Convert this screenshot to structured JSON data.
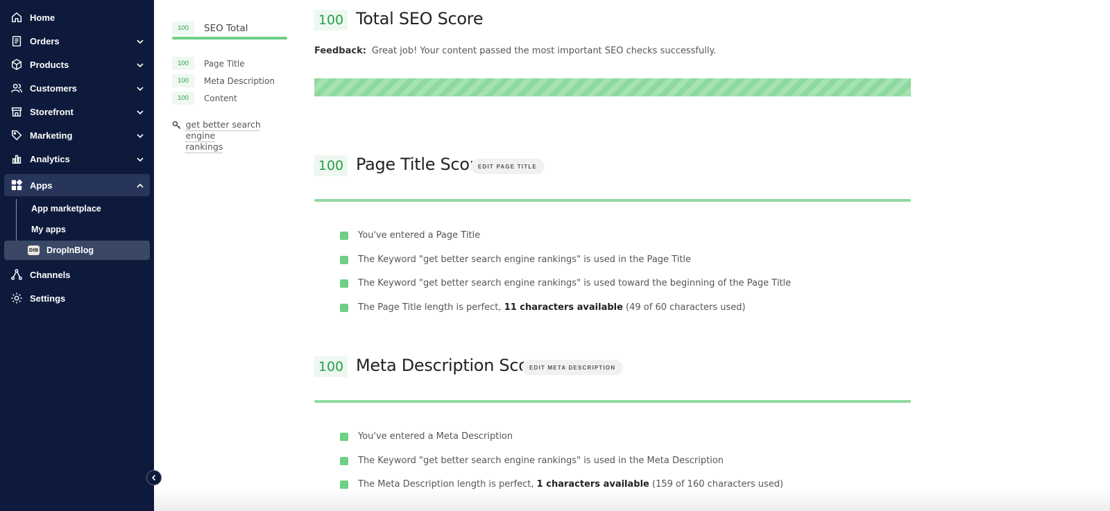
{
  "sidebar": {
    "items": [
      {
        "label": "Home",
        "icon": "home-icon"
      },
      {
        "label": "Orders",
        "icon": "orders-icon"
      },
      {
        "label": "Products",
        "icon": "box-icon"
      },
      {
        "label": "Customers",
        "icon": "users-icon"
      },
      {
        "label": "Storefront",
        "icon": "storefront-icon"
      },
      {
        "label": "Marketing",
        "icon": "tag-icon"
      },
      {
        "label": "Analytics",
        "icon": "bar-chart-icon"
      },
      {
        "label": "Apps",
        "icon": "apps-icon"
      },
      {
        "label": "Channels",
        "icon": "channels-icon"
      },
      {
        "label": "Settings",
        "icon": "gear-icon"
      }
    ],
    "apps_sub": {
      "marketplace": "App marketplace",
      "my_apps": "My apps",
      "dropinblog": "DropInBlog",
      "dropinblog_logo": "DIB"
    }
  },
  "toc": {
    "total_score": "100",
    "total_label": "SEO Total",
    "items": [
      {
        "score": "100",
        "label": "Page Title"
      },
      {
        "score": "100",
        "label": "Meta Description"
      },
      {
        "score": "100",
        "label": "Content"
      }
    ],
    "keyword_line1": "get better search engine",
    "keyword_line2": "rankings"
  },
  "total": {
    "score": "100",
    "title": "Total SEO Score",
    "feedback_label": "Feedback:",
    "feedback_text": "Great job! Your content passed the most important SEO checks successfully.",
    "progress_percent": 100
  },
  "page_title": {
    "score": "100",
    "title": "Page Title Score",
    "edit_label": "EDIT PAGE TITLE",
    "checks": [
      "You've entered a Page Title",
      "The Keyword \"get better search engine rankings\" is used in the Page Title",
      "The Keyword \"get better search engine rankings\" is used toward the beginning of the Page Title"
    ],
    "length_pre": "The Page Title length is perfect, ",
    "length_bold": "11 characters available",
    "length_post": " (49 of 60 characters used)"
  },
  "meta": {
    "score": "100",
    "title": "Meta Description Score",
    "edit_label": "EDIT META DESCRIPTION",
    "checks": [
      "You've entered a Meta Description",
      "The Keyword \"get better search engine rankings\" is used in the Meta Description"
    ],
    "length_pre": "The Meta Description length is perfect, ",
    "length_bold": "1 characters available",
    "length_post": " (159 of 160 characters used)"
  },
  "colors": {
    "sidebar_bg": "#0d1a3b",
    "score_green": "#26a046",
    "bar_green": "#8fd9a0"
  }
}
